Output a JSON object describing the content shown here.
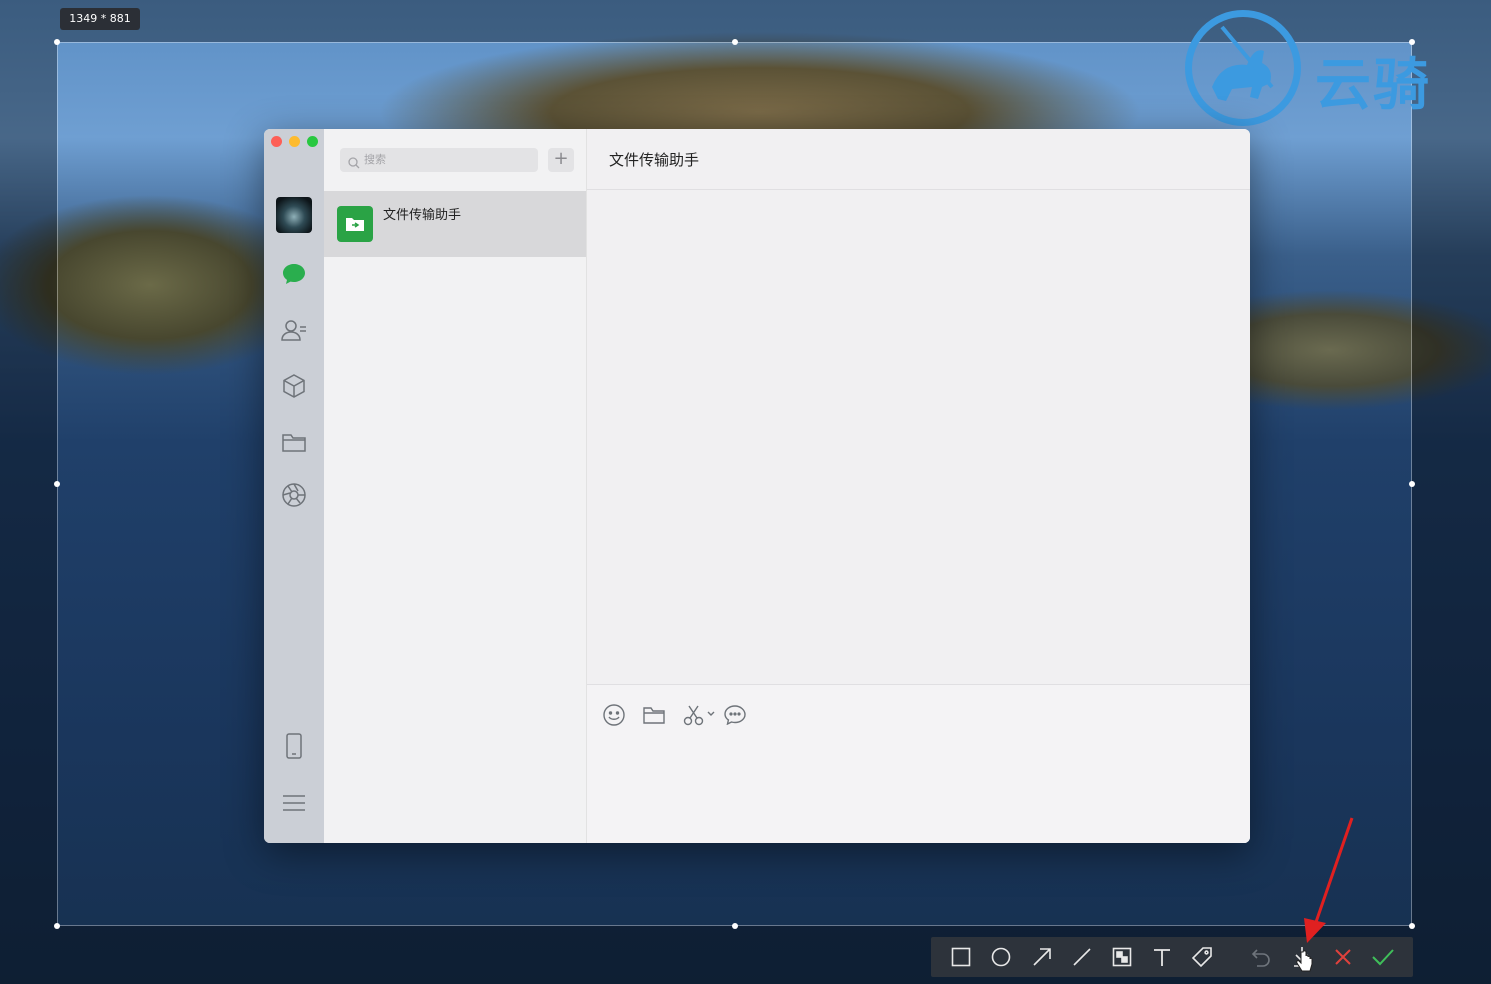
{
  "selection_size_label": "1349 * 881",
  "watermark": {
    "text": "云骑"
  },
  "wechat": {
    "search_placeholder": "搜索",
    "add_label": "+",
    "chat_list": [
      {
        "name": "文件传输助手"
      }
    ],
    "main_title": "文件传输助手"
  },
  "colors": {
    "accent_green": "#2aa345",
    "toolbar_bg": "#2d333b",
    "cancel_red": "#e0413c",
    "confirm_green": "#3fbf5a",
    "annotation_red": "#e02020"
  }
}
